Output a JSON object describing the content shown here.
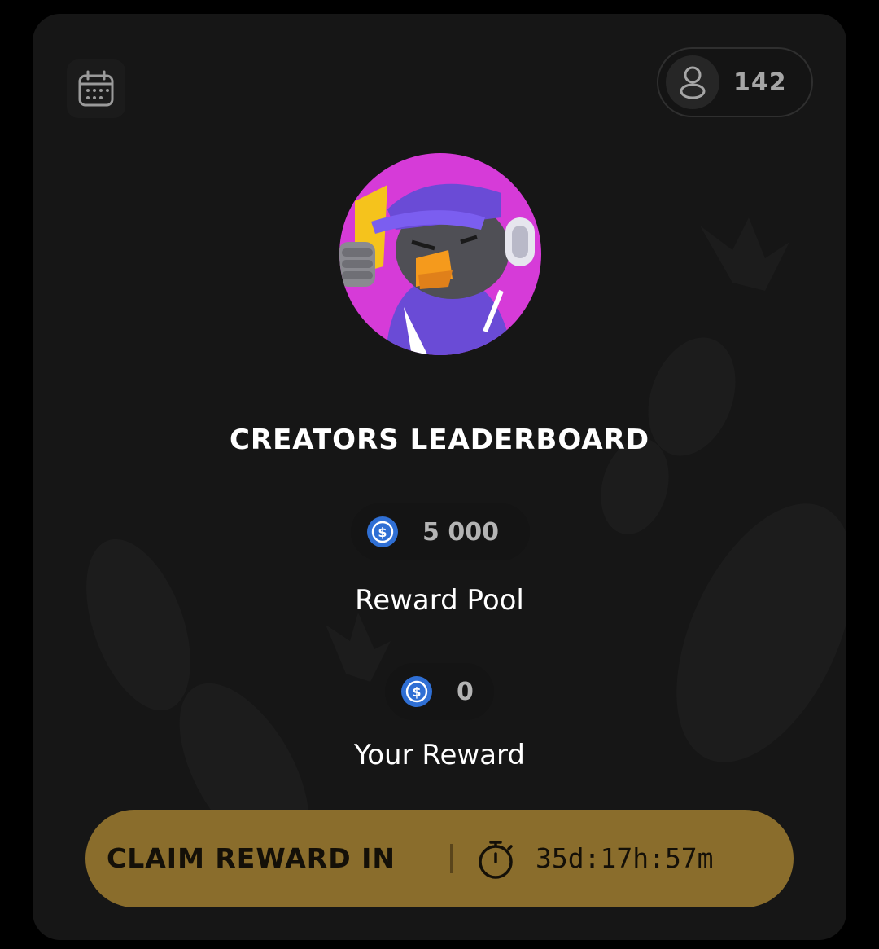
{
  "header": {
    "calendar_icon": "calendar-icon",
    "participants_icon": "user-icon",
    "participants_count": "142"
  },
  "mascot": {
    "description_icon": "duck-mascot-avatar",
    "accent_colors": [
      "#d63bd8",
      "#6a4bd6",
      "#f59a1c"
    ]
  },
  "leaderboard": {
    "title": "CREATORS LEADERBOARD",
    "reward_pool_amount": "5 000",
    "reward_pool_label": "Reward Pool",
    "your_reward_amount": "0",
    "your_reward_label": "Your Reward",
    "coin_icon": "usdc-coin-icon"
  },
  "claim": {
    "label": "CLAIM REWARD IN",
    "timer_icon": "stopwatch-icon",
    "countdown": "35d:17h:57m",
    "accent_color": "#8a6d2c"
  }
}
